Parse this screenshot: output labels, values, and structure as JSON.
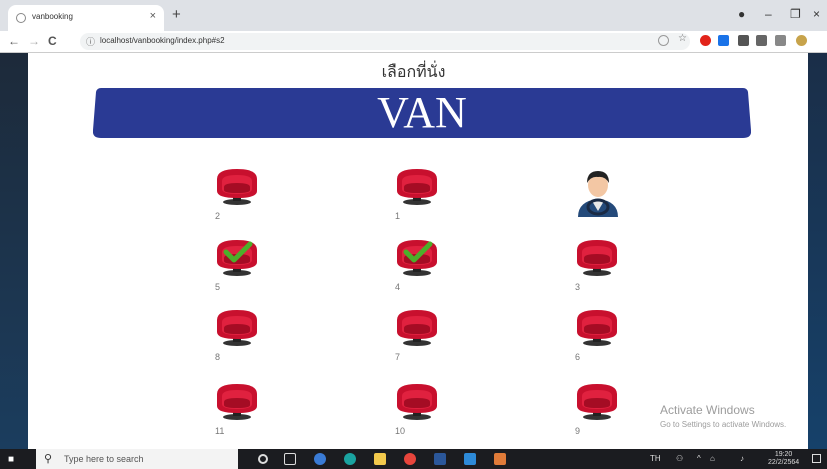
{
  "browser": {
    "tab_title": "vanbooking",
    "tab_close": "×",
    "new_tab": "+",
    "url": "localhost/vanbooking/index.php#s2",
    "back": "←",
    "forward": "→",
    "reload": "C",
    "info": "ⓘ",
    "minimize": "–",
    "restore": "❐",
    "close": "×"
  },
  "page": {
    "title": "เลือกที่นั่ง",
    "banner": "VAN",
    "banner_color": "#2a3a94"
  },
  "seats": [
    {
      "number": "2",
      "booked": false
    },
    {
      "number": "1",
      "booked": false
    },
    {
      "number": "5",
      "booked": true
    },
    {
      "number": "4",
      "booked": true
    },
    {
      "number": "3",
      "booked": false
    },
    {
      "number": "8",
      "booked": false
    },
    {
      "number": "7",
      "booked": false
    },
    {
      "number": "6",
      "booked": false
    },
    {
      "number": "11",
      "booked": false
    },
    {
      "number": "10",
      "booked": false
    },
    {
      "number": "9",
      "booked": false
    }
  ],
  "watermark": {
    "line1": "Activate Windows",
    "line2": "Go to Settings to activate Windows."
  },
  "taskbar": {
    "search_placeholder": "Type here to search",
    "language": "TH",
    "time": "19:20",
    "date": "22/2/2564"
  },
  "colors": {
    "seat_red": "#c8102e",
    "check_green": "#4caf2a"
  }
}
